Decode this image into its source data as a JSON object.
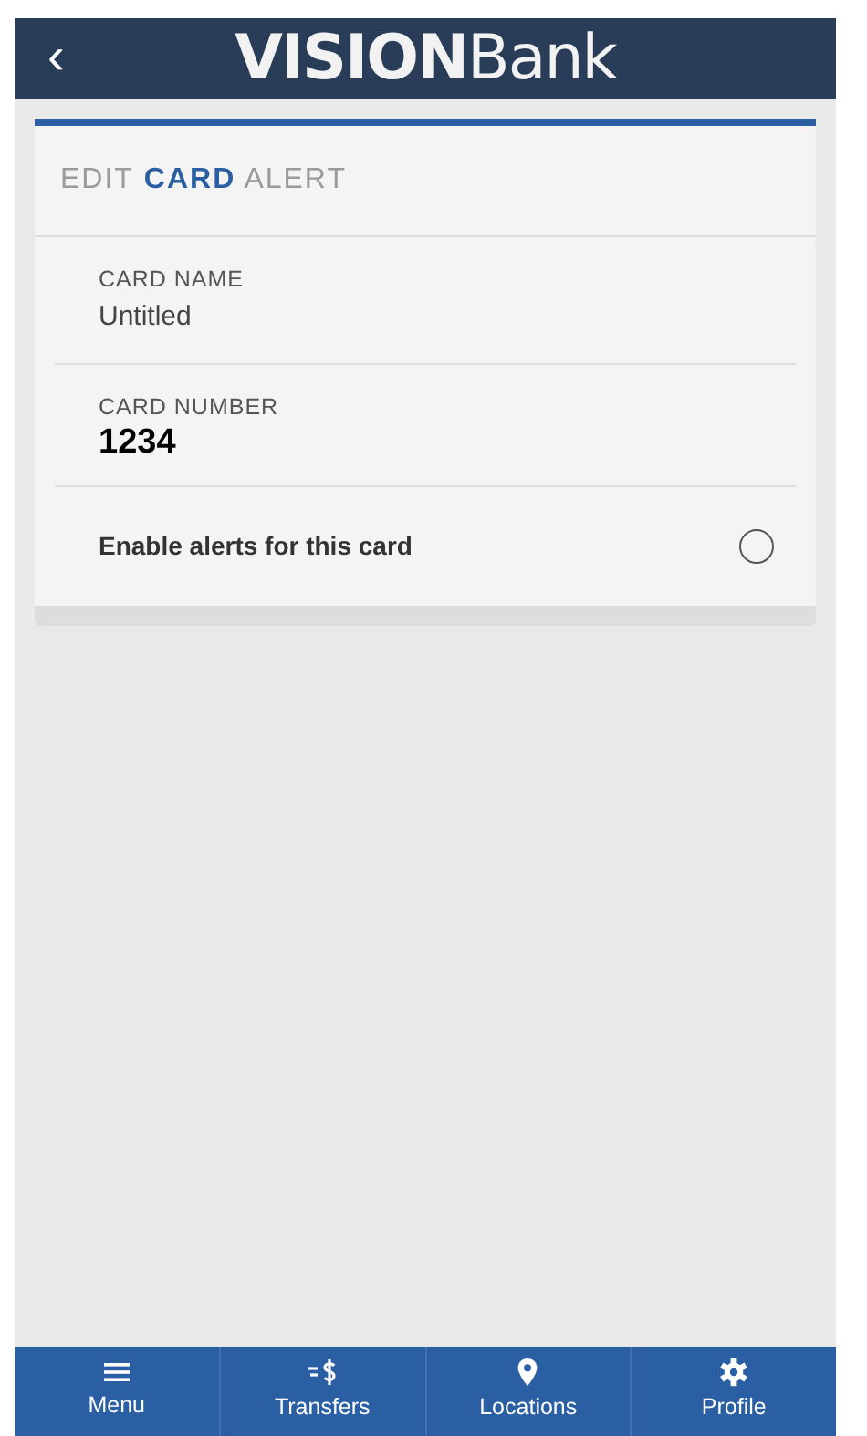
{
  "header": {
    "back": "‹",
    "brand_bold": "VISION",
    "brand_light": "Bank"
  },
  "card": {
    "title": [
      {
        "text": "EDIT",
        "accent": false
      },
      {
        "text": "CARD",
        "accent": true
      },
      {
        "text": "ALERT",
        "accent": false
      }
    ],
    "fields": [
      {
        "label": "CARD NAME",
        "value": "Untitled",
        "kind": "plain"
      },
      {
        "label": "CARD NUMBER",
        "value": "1234",
        "kind": "number"
      }
    ],
    "toggle": {
      "label": "Enable alerts for this card",
      "checked": false
    }
  },
  "nav": [
    {
      "label": "Menu",
      "kind": "menu"
    },
    {
      "label": "Transfers",
      "kind": "transfer"
    },
    {
      "label": "Locations",
      "kind": "pin"
    },
    {
      "label": "Profile",
      "kind": "gear"
    }
  ]
}
